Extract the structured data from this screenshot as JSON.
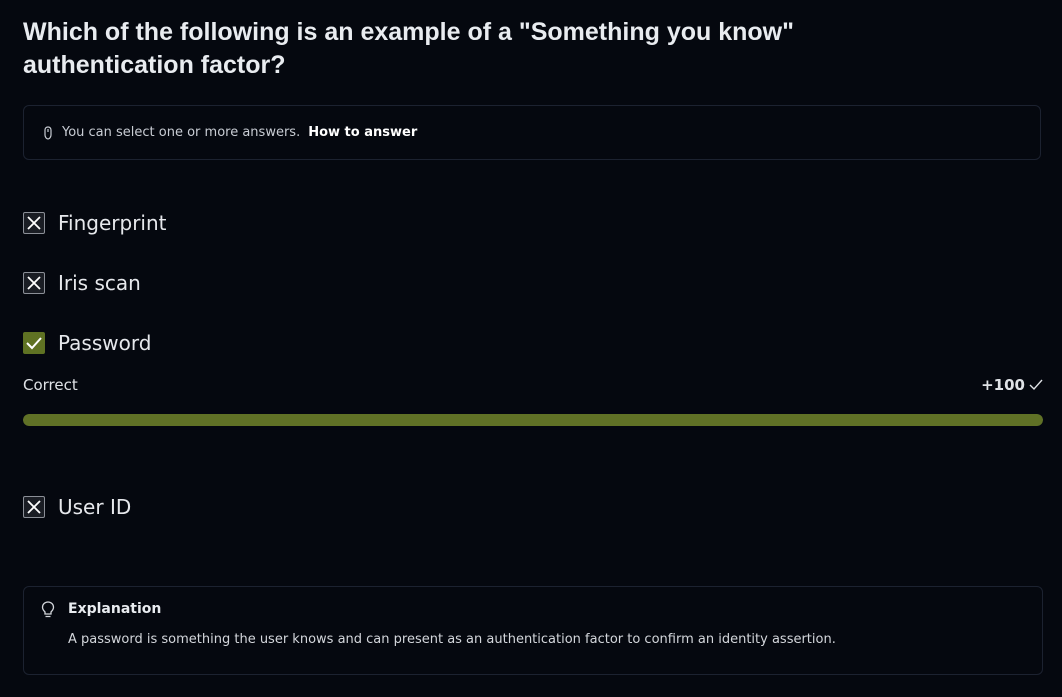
{
  "question": "Which of the following is an example of a \"Something you know\" authentication factor?",
  "hint": {
    "text": "You can select one or more answers.",
    "link": "How to answer"
  },
  "options": [
    {
      "label": "Fingerprint",
      "state": "incorrect"
    },
    {
      "label": "Iris scan",
      "state": "incorrect"
    },
    {
      "label": "Password",
      "state": "correct"
    },
    {
      "label": "User ID",
      "state": "incorrect"
    }
  ],
  "result": {
    "status": "Correct",
    "points": "+100",
    "progress": 1.0
  },
  "explanation": {
    "title": "Explanation",
    "body": "A password is something the user knows and can present as an authentication factor to confirm an identity assertion."
  },
  "colors": {
    "background": "#05080f",
    "correct": "#5f7223",
    "border": "#1c2230"
  }
}
